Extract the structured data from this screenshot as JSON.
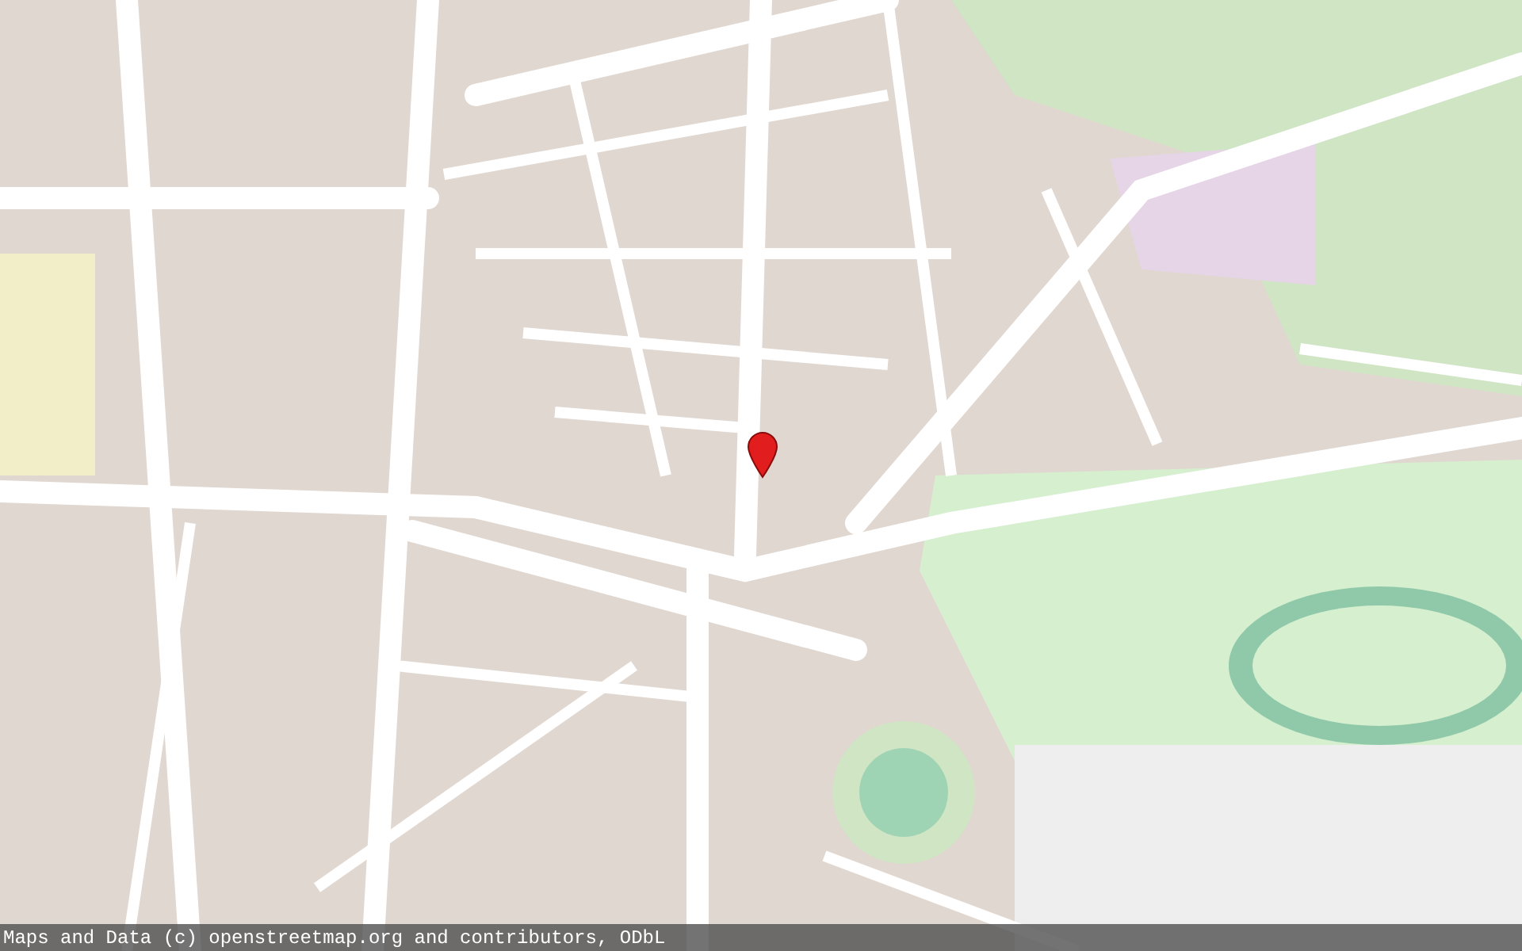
{
  "map": {
    "attribution": "Maps and Data (c) openstreetmap.org and contributors, ODbL"
  }
}
